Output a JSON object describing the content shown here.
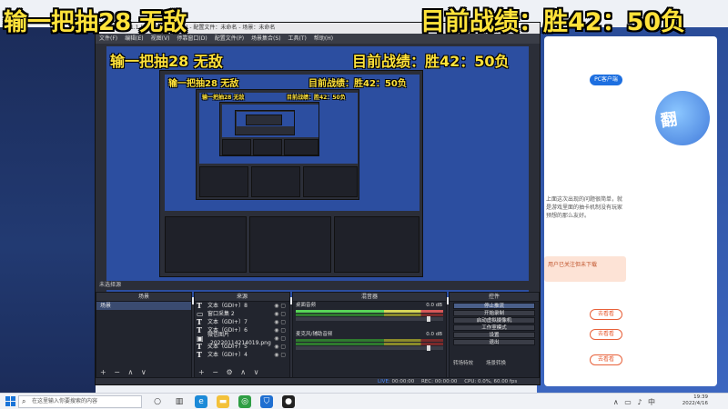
{
  "overlay": {
    "left_text": "输一把抽28 无敌",
    "right_text": "目前战绩：胜42：50负"
  },
  "obs": {
    "title": "OBS 26.1.1 (64-bit, windows) - 配置文件：未命名 - 场景：未命名",
    "menu": [
      "文件(F)",
      "编辑(E)",
      "视图(V)",
      "停靠窗口(D)",
      "配置文件(P)",
      "场景集合(S)",
      "工具(T)",
      "帮助(H)"
    ],
    "scenes_dock": {
      "header": "场景",
      "items": [
        "场景"
      ]
    },
    "sources_dock": {
      "header": "来源",
      "items": [
        {
          "icon": "T",
          "label": "文本（GDI+）8"
        },
        {
          "icon": "▭",
          "label": "窗口采集 2"
        },
        {
          "icon": "T",
          "label": "文本（GDI+）7"
        },
        {
          "icon": "T",
          "label": "文本（GDI+）6"
        },
        {
          "icon": "▣",
          "label": "微信图片_20220114214019.png"
        },
        {
          "icon": "T",
          "label": "文本（GDI+）5"
        },
        {
          "icon": "T",
          "label": "文本（GDI+）4"
        }
      ]
    },
    "mixer_dock": {
      "header": "混音器",
      "tracks": [
        {
          "name": "桌面音频",
          "db": "0.0 dB"
        },
        {
          "name": "麦克风/辅助音频",
          "db": "0.0 dB"
        }
      ]
    },
    "controls_dock": {
      "header": "控件",
      "buttons": [
        "停止推流",
        "开始录制",
        "启动虚拟摄像机",
        "工作室模式",
        "设置",
        "退出"
      ]
    },
    "tabs": {
      "left": "转场特效",
      "right": "场景转换"
    },
    "status": {
      "live_label": "LIVE:",
      "live_time": "00:00:00",
      "rec_label": "REC:",
      "rec_time": "00:00:00",
      "cpu": "CPU: 0.0%, 60.00 fps"
    },
    "scene_label": "未选择源",
    "footer_scene": "+ − ∧ ∨",
    "footer_sources": "+ − ⚙ ∧ ∨"
  },
  "background_page": {
    "top_pill": "PC客户端",
    "article": "上面这次出现的问题很简单，就是游戏里面的抽卡机制没有玩家预想的那么友好。",
    "btn1": "去看看",
    "btn2": "去看看",
    "btn3": "去看看",
    "orange_note": "用户已关注但未下载"
  },
  "taskbar": {
    "search_placeholder": "在这里输入你要搜索的内容",
    "time": "19:39",
    "date": "2022/4/16"
  },
  "colors": {
    "overlay_yellow": "#ffe23a",
    "obs_dark": "#2b2e38",
    "preview_blue": "#2c4ea0",
    "accent_red": "#e8613a"
  }
}
